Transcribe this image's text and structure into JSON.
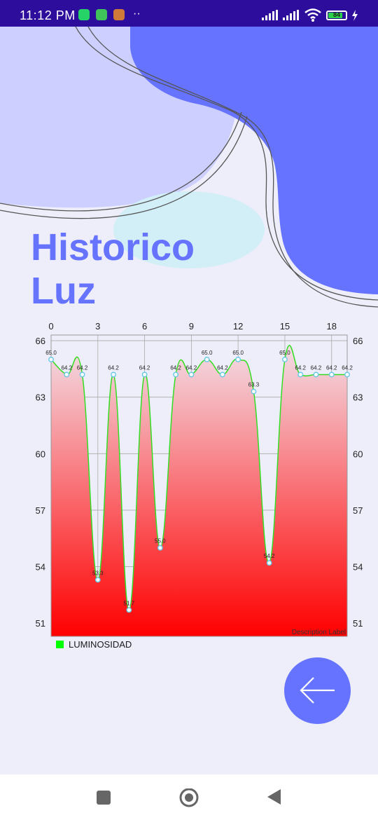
{
  "status_bar": {
    "time": "11:12 PM",
    "battery": "84",
    "battery_level": 0.84,
    "icons": [
      "whatsapp-icon",
      "app-icon",
      "app-icon",
      "more-dots-icon",
      "signal-icon",
      "signal-icon",
      "wifi-icon",
      "battery-icon",
      "charging-icon"
    ]
  },
  "page": {
    "title": "Historico\nLuz"
  },
  "colors": {
    "accent": "#6673ff",
    "light_blob": "#cdd0ff",
    "cyan_blob": "#d2eef7",
    "status_bar": "#2d0d9c",
    "line": "#33dd22",
    "fill_top": "#f3dde6",
    "fill_bottom": "#ff0000"
  },
  "chart_data": {
    "type": "line",
    "x": [
      0,
      1,
      2,
      3,
      4,
      5,
      6,
      7,
      8,
      9,
      10,
      11,
      12,
      13,
      14,
      15,
      16,
      17,
      18,
      19
    ],
    "series": [
      {
        "name": "LUMINOSIDAD",
        "values": [
          65.0,
          64.2,
          64.2,
          53.3,
          64.2,
          51.7,
          64.2,
          55.0,
          64.2,
          64.2,
          65.0,
          64.2,
          65.0,
          63.3,
          54.2,
          65.0,
          64.2,
          64.2,
          64.2,
          64.2
        ],
        "labels": [
          "65.0",
          "64.2",
          "64.2",
          "53.3",
          "64.2",
          "51.7",
          "64.2",
          "55.0",
          "64.2",
          "64.2",
          "65.0",
          "64.2",
          "65.0",
          "63.3",
          "54.2",
          "65.0",
          "64.2",
          "64.2",
          "64.2",
          "64.2"
        ]
      }
    ],
    "x_ticks": [
      "0",
      "3",
      "6",
      "9",
      "12",
      "15",
      "18"
    ],
    "x_tick_values": [
      0,
      3,
      6,
      9,
      12,
      15,
      18
    ],
    "y_ticks": [
      "66",
      "63",
      "60",
      "57",
      "54",
      "51"
    ],
    "y_tick_values": [
      66,
      63,
      60,
      57,
      54,
      51
    ],
    "xlim": [
      0,
      19
    ],
    "ylim": [
      50.3,
      66.3
    ],
    "description": "Description Label",
    "grid": true,
    "legend_position": "bottom-left",
    "fill": "gradient"
  },
  "back_button": {
    "icon": "arrow-left-icon"
  },
  "nav_bar": {
    "icons": [
      "square-icon",
      "circle-home-icon",
      "triangle-back-icon"
    ]
  }
}
